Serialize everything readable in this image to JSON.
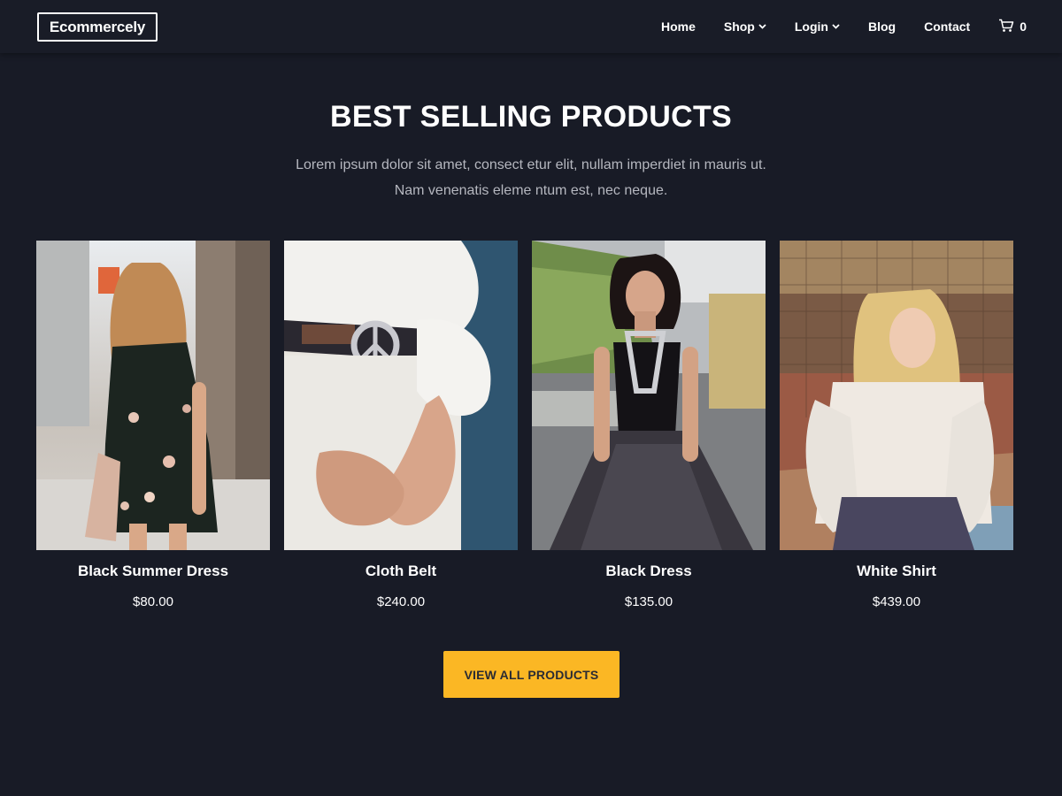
{
  "brand": {
    "logo_text": "Ecommercely"
  },
  "nav": {
    "items": [
      {
        "label": "Home",
        "has_dropdown": false
      },
      {
        "label": "Shop",
        "has_dropdown": true
      },
      {
        "label": "Login",
        "has_dropdown": true
      },
      {
        "label": "Blog",
        "has_dropdown": false
      },
      {
        "label": "Contact",
        "has_dropdown": false
      }
    ],
    "cart": {
      "icon": "cart-icon",
      "count": "0"
    }
  },
  "section": {
    "title": "BEST SELLING PRODUCTS",
    "description_line1": "Lorem ipsum dolor sit amet, consect etur elit, nullam imperdiet in mauris ut.",
    "description_line2": "Nam venenatis eleme ntum est, nec neque."
  },
  "products": [
    {
      "name": "Black Summer Dress",
      "price": "$80.00"
    },
    {
      "name": "Cloth Belt",
      "price": "$240.00"
    },
    {
      "name": "Black Dress",
      "price": "$135.00"
    },
    {
      "name": "White Shirt",
      "price": "$439.00"
    }
  ],
  "cta": {
    "label": "VIEW ALL PRODUCTS"
  },
  "colors": {
    "background": "#181b26",
    "navbar": "#191c27",
    "accent": "#fbb724",
    "muted_text": "#b5b7bf"
  }
}
